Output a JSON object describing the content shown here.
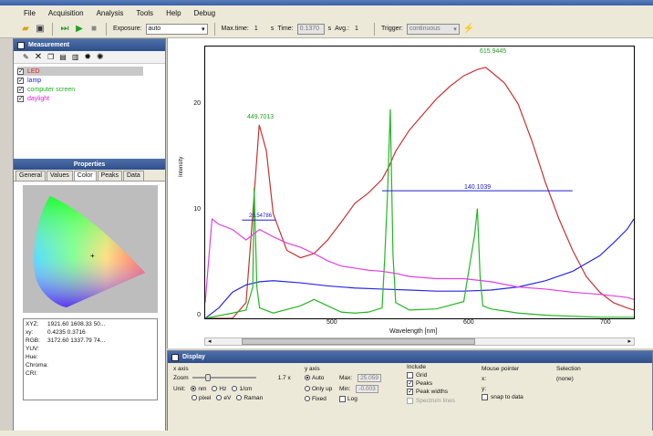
{
  "menu": [
    "File",
    "Acquisition",
    "Analysis",
    "Tools",
    "Help",
    "Debug"
  ],
  "toolbar": {
    "exposure_label": "Exposure:",
    "exposure_value": "auto",
    "max_time_label": "Max.time:",
    "max_time_value": "1",
    "max_time_unit": "s",
    "time_label": "Time:",
    "time_value": "0.1370",
    "time_unit": "s",
    "avg_label": "Avg.:",
    "avg_value": "1",
    "trigger_label": "Trigger:",
    "trigger_value": "continuous"
  },
  "measurement": {
    "title": "Measurement",
    "items": [
      {
        "label": "LED",
        "color": "#e02020",
        "checked": true
      },
      {
        "label": "lamp",
        "color": "#2020e0",
        "checked": true
      },
      {
        "label": "computer screen",
        "color": "#20b020",
        "checked": true
      },
      {
        "label": "daylight",
        "color": "#e020e0",
        "checked": true
      }
    ]
  },
  "properties": {
    "title": "Properties",
    "tabs": [
      "General",
      "Values",
      "Color",
      "Peaks",
      "Data"
    ],
    "active_tab": "Color",
    "values": [
      {
        "k": "XYZ:",
        "v": "1921.60  1608.33  50..."
      },
      {
        "k": "xy:",
        "v": "0.4235  0.3716"
      },
      {
        "k": "RGB:",
        "v": "3172.60  1337.79  74..."
      },
      {
        "k": "YUV:",
        "v": ""
      },
      {
        "k": "Hue:",
        "v": ""
      },
      {
        "k": "Chroma:",
        "v": ""
      },
      {
        "k": "CRI:",
        "v": ""
      }
    ]
  },
  "chart": {
    "ylabel": "Intensity",
    "xlabel": "Wavelength [nm]",
    "yticks": [
      "20",
      "10",
      "0"
    ],
    "xticks": [
      "500",
      "600",
      "700"
    ],
    "annotations": [
      "615.9445",
      "449.7013",
      "140.1039",
      "26.54786"
    ]
  },
  "chart_data": {
    "type": "line",
    "xlim": [
      410,
      725
    ],
    "ylim": [
      0,
      26
    ],
    "ylabel": "Intensity",
    "xlabel": "Wavelength [nm]",
    "series": [
      {
        "name": "LED",
        "color": "#c83232",
        "x": [
          410,
          430,
          440,
          445,
          449.7,
          455,
          460,
          470,
          480,
          490,
          500,
          510,
          520,
          530,
          540,
          545,
          550,
          560,
          570,
          580,
          590,
          600,
          610,
          616,
          620,
          630,
          640,
          650,
          660,
          670,
          680,
          690,
          700,
          710,
          720,
          725
        ],
        "y": [
          0,
          0,
          1.5,
          10,
          18.5,
          16,
          10,
          6.5,
          5.8,
          6.2,
          7.5,
          9.2,
          11,
          12,
          13.3,
          14.5,
          16,
          18,
          19.5,
          21,
          22.2,
          23.2,
          23.8,
          24,
          23.6,
          22.5,
          20.5,
          17,
          13,
          9.5,
          6.5,
          4,
          2.5,
          1.5,
          1,
          0.8
        ]
      },
      {
        "name": "lamp",
        "color": "#2828e0",
        "x": [
          410,
          420,
          430,
          440,
          450,
          460,
          480,
          500,
          520,
          540,
          560,
          580,
          600,
          620,
          640,
          660,
          680,
          700,
          710,
          720,
          725
        ],
        "y": [
          0,
          1,
          2.5,
          3.2,
          3.5,
          3.6,
          3.4,
          3.1,
          2.9,
          2.8,
          2.7,
          2.6,
          2.6,
          2.7,
          3,
          3.6,
          4.5,
          6,
          7.2,
          8.5,
          9.5
        ]
      },
      {
        "name": "computer screen",
        "color": "#22b822",
        "x": [
          410,
          430,
          440,
          445,
          446,
          448,
          450,
          460,
          480,
          490,
          500,
          510,
          520,
          530,
          540,
          542,
          544,
          546,
          548,
          550,
          560,
          580,
          600,
          608,
          610,
          612,
          614,
          620,
          640,
          660,
          680,
          700,
          720,
          725
        ],
        "y": [
          0,
          0.5,
          0.8,
          3,
          12.5,
          3,
          1,
          0.5,
          1.2,
          1.8,
          1.2,
          0.6,
          0.5,
          0.6,
          1,
          6,
          12,
          20,
          6,
          1.5,
          0.8,
          0.9,
          1.6,
          8,
          10.5,
          4,
          1.2,
          0.9,
          0.5,
          0.3,
          0.2,
          0.1,
          0.1,
          0.1
        ]
      },
      {
        "name": "daylight",
        "color": "#e040e0",
        "x": [
          410,
          415,
          420,
          430,
          440,
          450,
          460,
          470,
          480,
          490,
          500,
          510,
          520,
          530,
          540,
          550,
          560,
          580,
          600,
          620,
          640,
          660,
          680,
          700,
          720,
          725
        ],
        "y": [
          1.5,
          9.5,
          9,
          8.5,
          7.5,
          8.5,
          7.8,
          7.2,
          6.8,
          6.2,
          5.5,
          5,
          4.8,
          4.6,
          4.5,
          4.3,
          4,
          3.8,
          3.8,
          3.5,
          3,
          2.8,
          2.5,
          2.3,
          2,
          1.8
        ]
      }
    ]
  },
  "display": {
    "title": "Display",
    "xaxis_label": "x axis",
    "zoom_label": "Zoom",
    "zoom_value": "1.7 x",
    "unit_label": "Unit:",
    "units": [
      "nm",
      "Hz",
      "1/cm",
      "pixel",
      "eV",
      "Raman"
    ],
    "unit_selected": "nm",
    "yaxis_label": "y axis",
    "yaxis_options": [
      "Auto",
      "Only up",
      "Fixed"
    ],
    "yaxis_selected": "Auto",
    "max_label": "Max:",
    "max_value": "25.059",
    "min_label": "Min:",
    "min_value": "-0.003",
    "log_label": "Log",
    "include_label": "Include",
    "include_items": [
      "Grid",
      "Peaks",
      "Peak widths",
      "Spectrum lines"
    ],
    "mouse_label": "Mouse pointer",
    "mouse_x": "x:",
    "mouse_y": "y:",
    "snap_label": "snap to data",
    "selection_label": "Selection",
    "selection_value": "(none)"
  }
}
